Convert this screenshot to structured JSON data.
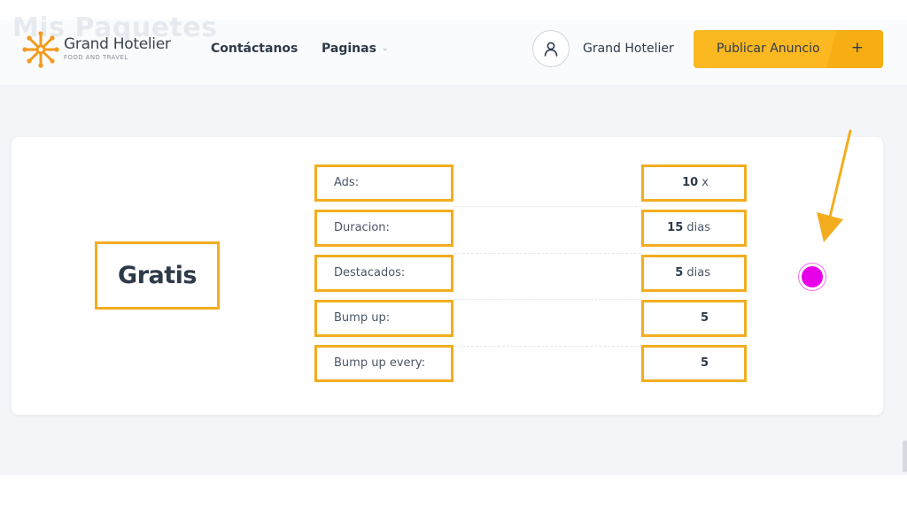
{
  "header": {
    "ghost_title": "Mis Paquetes",
    "logo": {
      "name": "Grand Hotelier",
      "tagline": "FOOD AND TRAVEL"
    },
    "nav": {
      "contact_label": "Contáctanos",
      "pages_label": "Paginas"
    },
    "user": {
      "name": "Grand Hotelier"
    },
    "publish_button": {
      "label": "Publicar Anuncio",
      "plus": "+"
    }
  },
  "plan": {
    "name": "Gratis",
    "features": [
      {
        "label": "Ads:",
        "value": "10",
        "unit": "x"
      },
      {
        "label": "Duracion:",
        "value": "15",
        "unit": "dias"
      },
      {
        "label": "Destacados:",
        "value": "5",
        "unit": "dias"
      },
      {
        "label": "Bump up:",
        "value": "5",
        "unit": ""
      },
      {
        "label": "Bump up every:",
        "value": "5",
        "unit": ""
      }
    ]
  },
  "colors": {
    "accent": "#fbb820",
    "highlight_border": "#f2ad1f",
    "select_dot": "#e800e8",
    "text_dark": "#2d3a4a"
  }
}
